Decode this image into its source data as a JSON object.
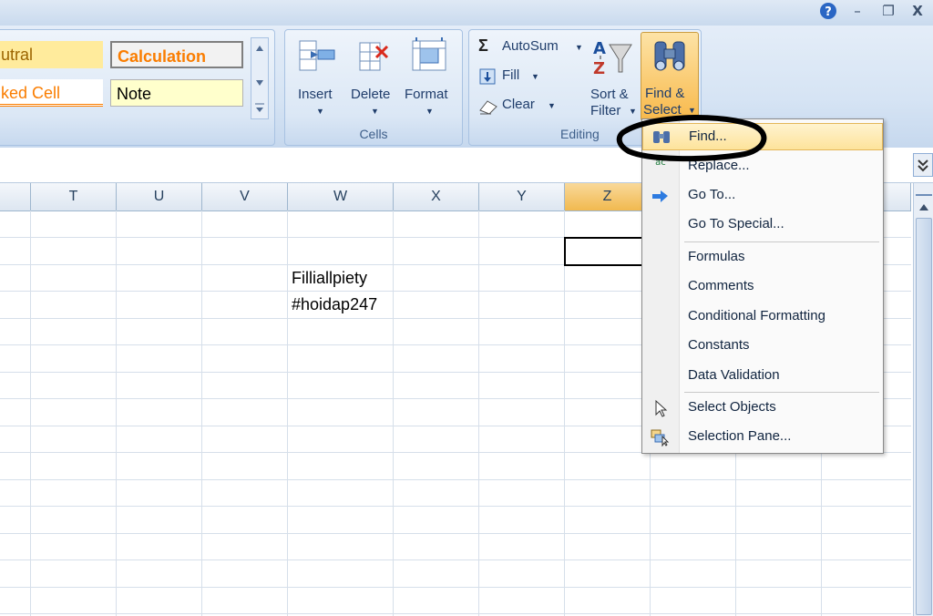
{
  "window": {
    "help_icon": "?",
    "minimize_icon": "–",
    "restore_icon": "❐",
    "close_icon": "X"
  },
  "styles": {
    "neutral_label": "utral",
    "calculation_label": "Calculation",
    "checked_cell_label": "ked Cell",
    "note_label": "Note"
  },
  "cells_group": {
    "label": "Cells",
    "insert_label": "Insert",
    "delete_label": "Delete",
    "format_label": "Format"
  },
  "editing_group": {
    "label": "Editing",
    "autosum_label": "AutoSum",
    "fill_label": "Fill",
    "clear_label": "Clear",
    "sort_label_1": "Sort &",
    "sort_label_2": "Filter",
    "find_label_1": "Find &",
    "find_label_2": "Select"
  },
  "columns": [
    "T",
    "U",
    "V",
    "W",
    "X",
    "Y",
    "Z"
  ],
  "selected_column": "Z",
  "cells": {
    "w3": "Filliallpiety",
    "w4": "#hoidap247"
  },
  "menu": {
    "items": [
      {
        "label": "Find...",
        "icon": "binoculars-icon"
      },
      {
        "label": "Replace...",
        "icon": "replace-icon"
      },
      {
        "label": "Go To...",
        "icon": "arrow-right-icon"
      },
      {
        "label": "Go To Special...",
        "icon": ""
      },
      {
        "label": "Formulas",
        "icon": ""
      },
      {
        "label": "Comments",
        "icon": ""
      },
      {
        "label": "Conditional Formatting",
        "icon": ""
      },
      {
        "label": "Constants",
        "icon": ""
      },
      {
        "label": "Data Validation",
        "icon": ""
      },
      {
        "label": "Select Objects",
        "icon": "cursor-icon"
      },
      {
        "label": "Selection Pane...",
        "icon": "selection-pane-icon"
      }
    ]
  },
  "colors": {
    "accent_orange": "#f5b24a",
    "calc_text": "#f07a1a",
    "ribbon_text": "#1f3d6b"
  }
}
